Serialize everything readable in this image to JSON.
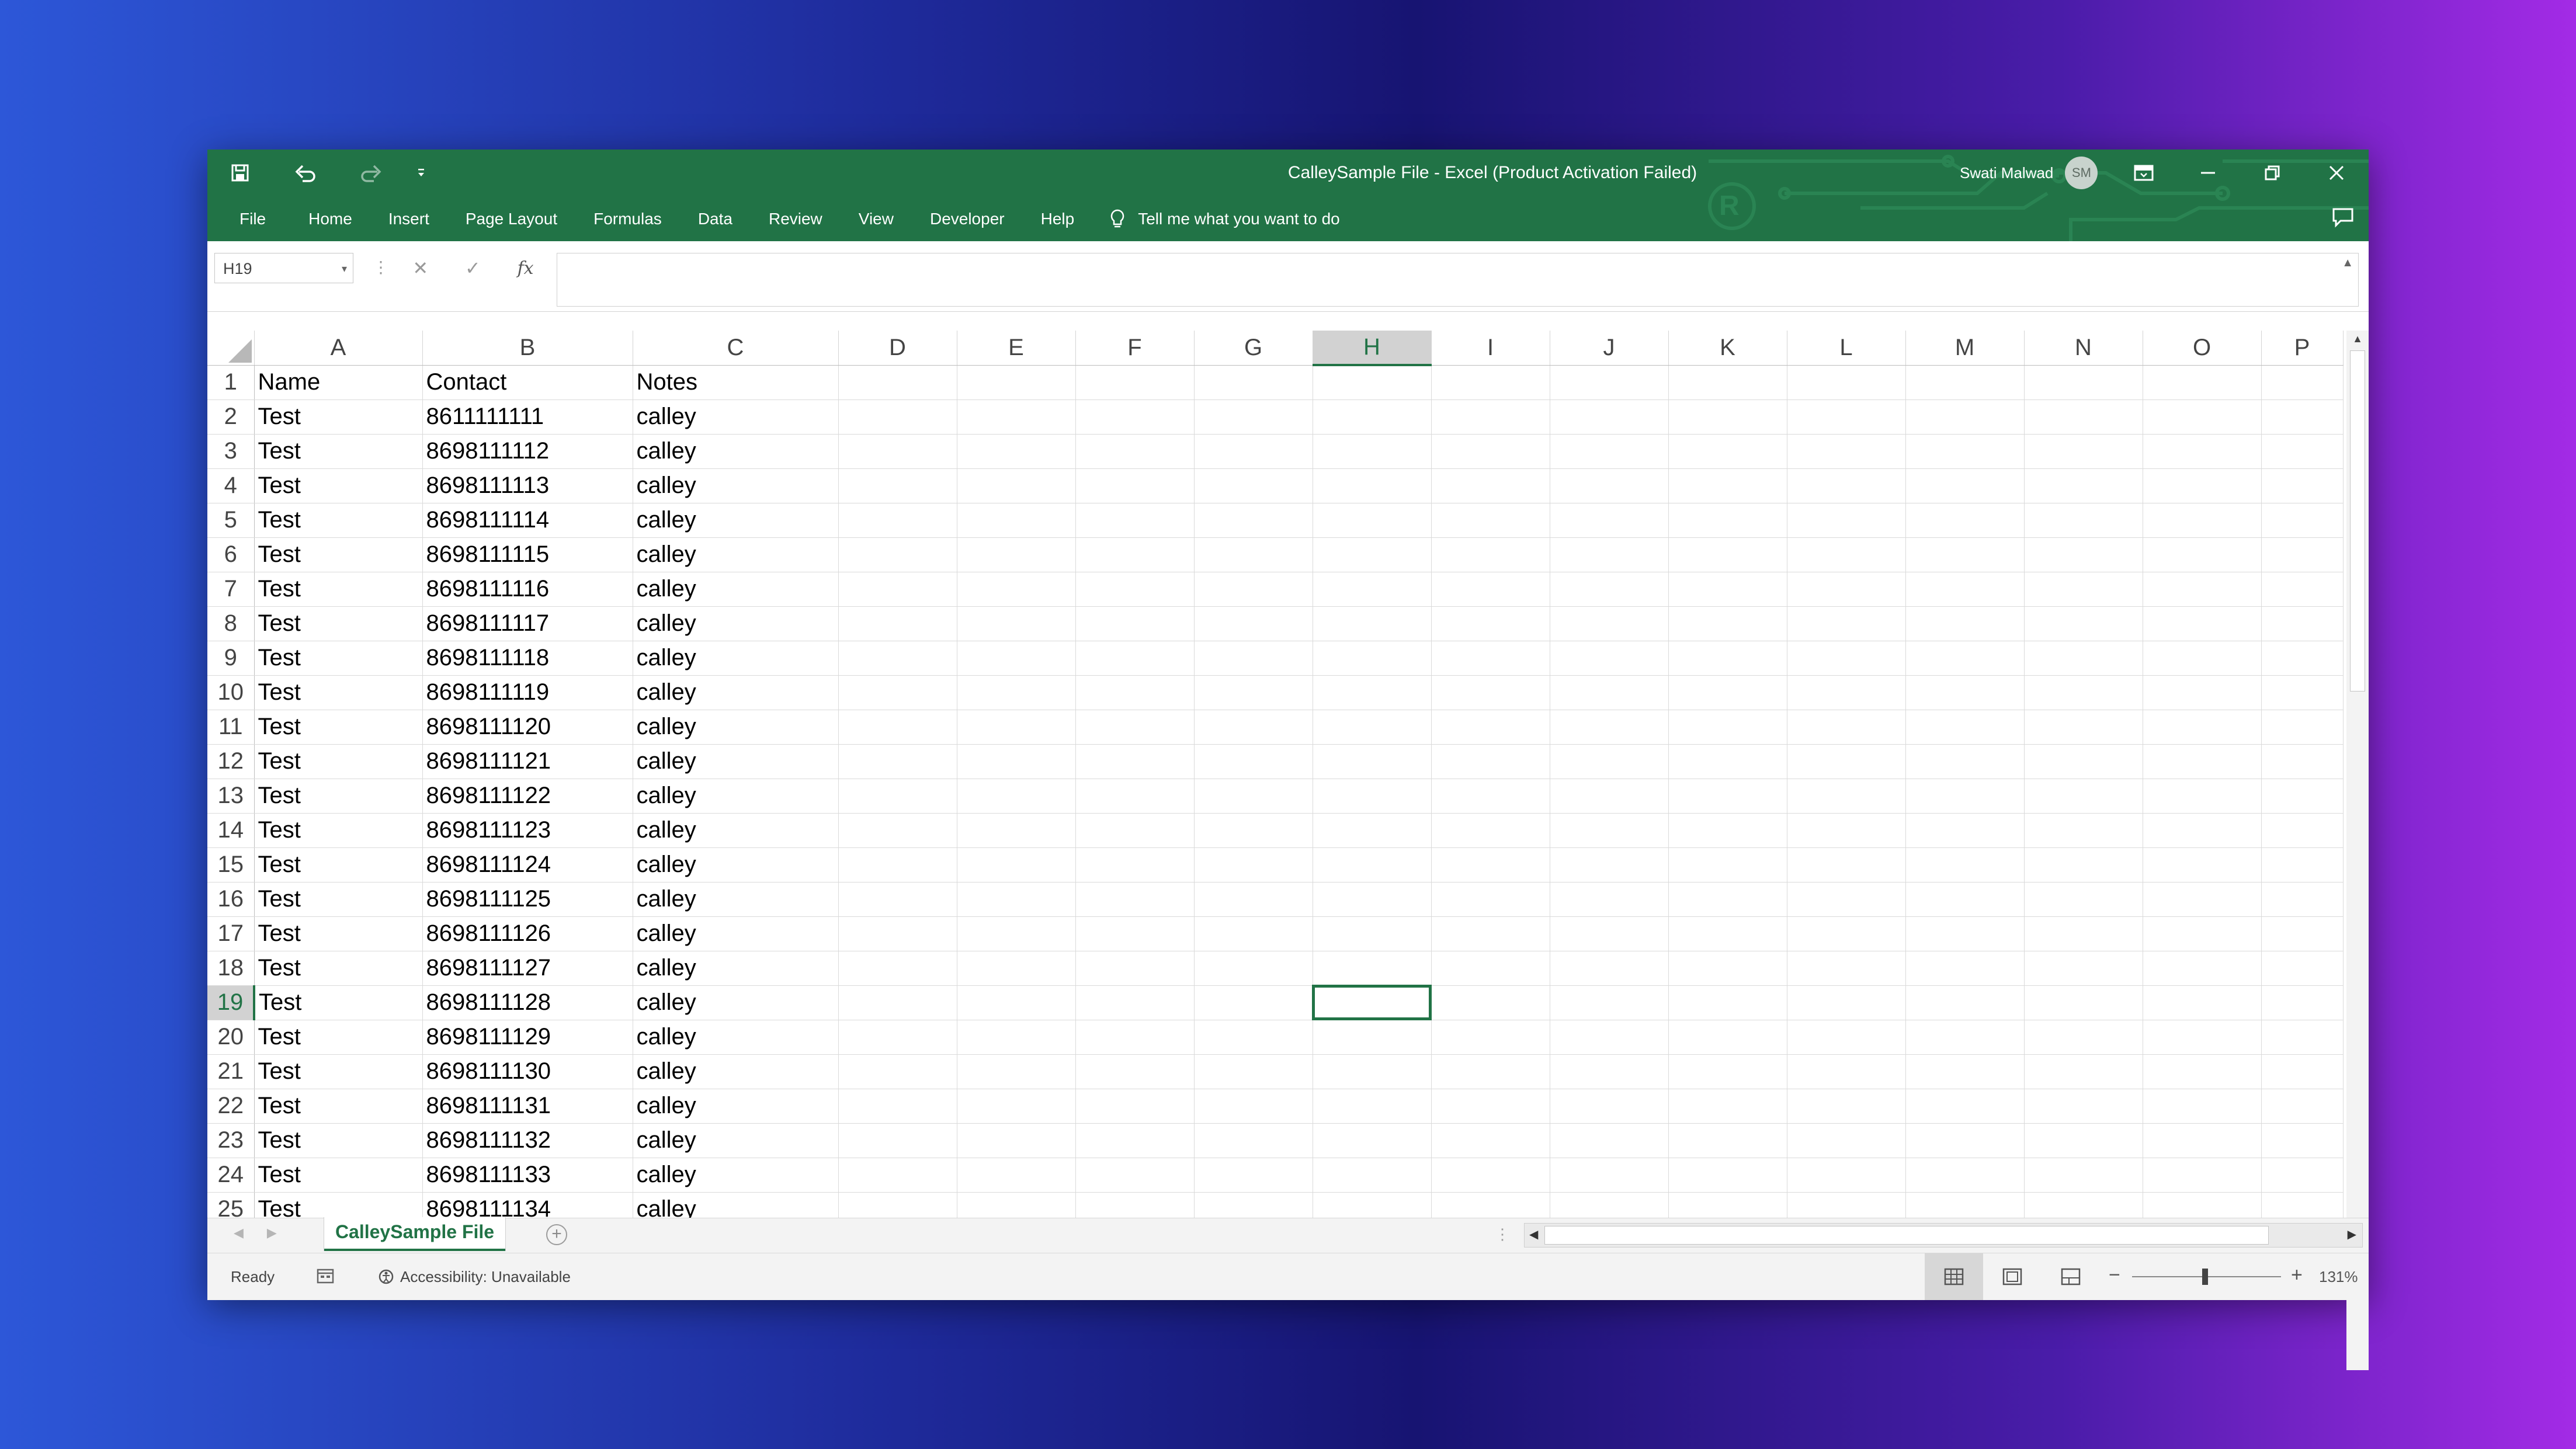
{
  "window": {
    "title": "CalleySample File  -  Excel (Product Activation Failed)",
    "user_name": "Swati Malwad",
    "user_initials": "SM"
  },
  "quick_access": [
    "save-icon",
    "undo-icon",
    "redo-icon",
    "customize-qat-icon"
  ],
  "ribbon_tabs": [
    "File",
    "Home",
    "Insert",
    "Page Layout",
    "Formulas",
    "Data",
    "Review",
    "View",
    "Developer",
    "Help"
  ],
  "tell_me": "Tell me what you want to do",
  "formula_bar": {
    "name_box": "H19",
    "formula": ""
  },
  "columns": [
    "A",
    "B",
    "C",
    "D",
    "E",
    "F",
    "G",
    "H",
    "I",
    "J",
    "K",
    "L",
    "M",
    "N",
    "O",
    "P"
  ],
  "selected_cell": {
    "column": "H",
    "row": 19
  },
  "rows": [
    {
      "n": "1",
      "A": "Name",
      "B": "Contact",
      "C": "Notes"
    },
    {
      "n": "2",
      "A": "Test",
      "B": "8611111111",
      "C": "calley"
    },
    {
      "n": "3",
      "A": "Test",
      "B": "8698111112",
      "C": "calley"
    },
    {
      "n": "4",
      "A": "Test",
      "B": "8698111113",
      "C": "calley"
    },
    {
      "n": "5",
      "A": "Test",
      "B": "8698111114",
      "C": "calley"
    },
    {
      "n": "6",
      "A": "Test",
      "B": "8698111115",
      "C": "calley"
    },
    {
      "n": "7",
      "A": "Test",
      "B": "8698111116",
      "C": "calley"
    },
    {
      "n": "8",
      "A": "Test",
      "B": "8698111117",
      "C": "calley"
    },
    {
      "n": "9",
      "A": "Test",
      "B": "8698111118",
      "C": "calley"
    },
    {
      "n": "10",
      "A": "Test",
      "B": "8698111119",
      "C": "calley"
    },
    {
      "n": "11",
      "A": "Test",
      "B": "8698111120",
      "C": "calley"
    },
    {
      "n": "12",
      "A": "Test",
      "B": "8698111121",
      "C": "calley"
    },
    {
      "n": "13",
      "A": "Test",
      "B": "8698111122",
      "C": "calley"
    },
    {
      "n": "14",
      "A": "Test",
      "B": "8698111123",
      "C": "calley"
    },
    {
      "n": "15",
      "A": "Test",
      "B": "8698111124",
      "C": "calley"
    },
    {
      "n": "16",
      "A": "Test",
      "B": "8698111125",
      "C": "calley"
    },
    {
      "n": "17",
      "A": "Test",
      "B": "8698111126",
      "C": "calley"
    },
    {
      "n": "18",
      "A": "Test",
      "B": "8698111127",
      "C": "calley"
    },
    {
      "n": "19",
      "A": "Test",
      "B": "8698111128",
      "C": "calley"
    },
    {
      "n": "20",
      "A": "Test",
      "B": "8698111129",
      "C": "calley"
    },
    {
      "n": "21",
      "A": "Test",
      "B": "8698111130",
      "C": "calley"
    },
    {
      "n": "22",
      "A": "Test",
      "B": "8698111131",
      "C": "calley"
    },
    {
      "n": "23",
      "A": "Test",
      "B": "8698111132",
      "C": "calley"
    },
    {
      "n": "24",
      "A": "Test",
      "B": "8698111133",
      "C": "calley"
    },
    {
      "n": "25",
      "A": "Test",
      "B": "8698111134",
      "C": "calley"
    }
  ],
  "sheet_tab": "CalleySample File",
  "status": {
    "ready": "Ready",
    "accessibility": "Accessibility: Unavailable",
    "zoom": "131%",
    "zoom_level": 131,
    "view": "normal"
  },
  "colors": {
    "excel_green": "#217346",
    "selection_header": "#d2d2d2"
  }
}
